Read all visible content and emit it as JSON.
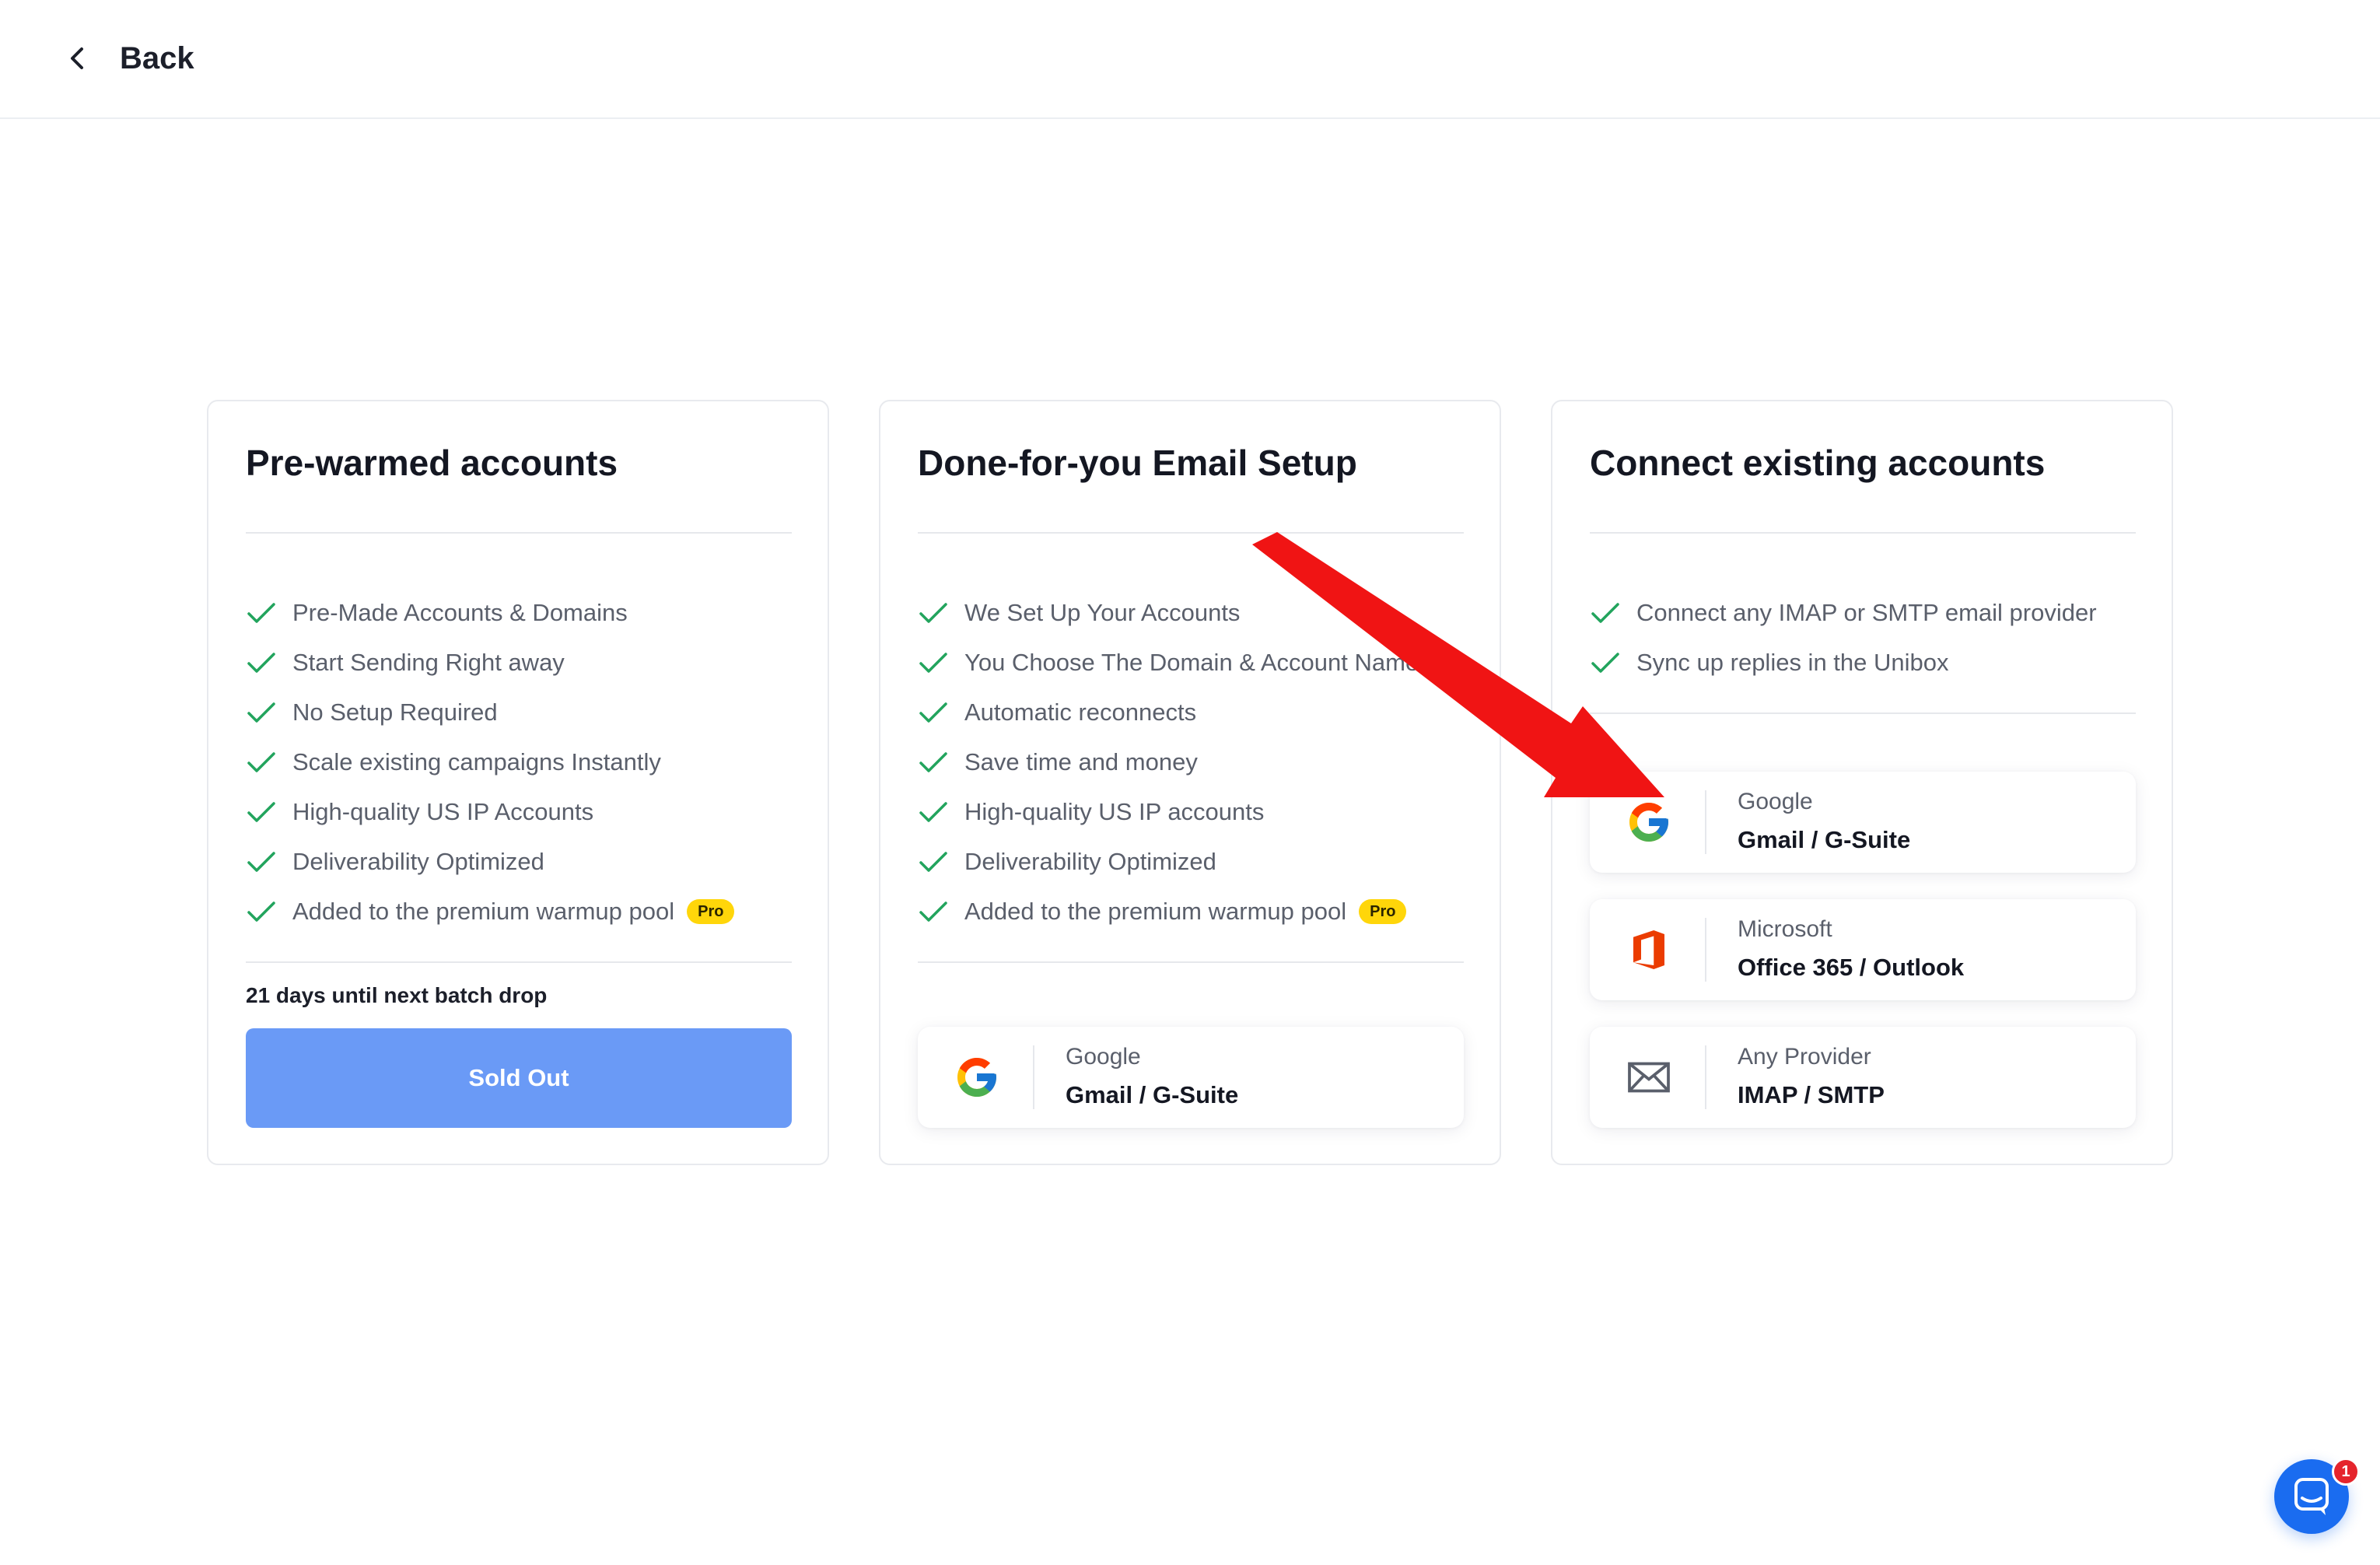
{
  "header": {
    "back_label": "Back"
  },
  "cards": [
    {
      "title": "Pre-warmed accounts",
      "features": [
        "Pre-Made Accounts & Domains",
        "Start Sending Right away",
        "No Setup Required",
        "Scale existing campaigns Instantly",
        "High-quality US IP Accounts",
        "Deliverability Optimized",
        "Added to the premium warmup pool"
      ],
      "pro_badge": "Pro",
      "batch_text": "21 days until next batch drop",
      "button_label": "Sold Out"
    },
    {
      "title": "Done-for-you Email Setup",
      "features": [
        "We Set Up Your Accounts",
        "You Choose The Domain & Account Names",
        "Automatic reconnects",
        "Save time and money",
        "High-quality US IP accounts",
        "Deliverability Optimized",
        "Added to the premium warmup pool"
      ],
      "pro_badge": "Pro",
      "provider": {
        "name": "Google",
        "product": "Gmail / G-Suite",
        "icon": "google-icon"
      }
    },
    {
      "title": "Connect existing accounts",
      "features": [
        "Connect any IMAP or SMTP email provider",
        "Sync up replies in the Unibox"
      ],
      "providers": [
        {
          "name": "Google",
          "product": "Gmail / G-Suite",
          "icon": "google-icon"
        },
        {
          "name": "Microsoft",
          "product": "Office 365 / Outlook",
          "icon": "office-icon"
        },
        {
          "name": "Any Provider",
          "product": "IMAP / SMTP",
          "icon": "envelope-icon"
        }
      ]
    }
  ],
  "chat": {
    "badge_count": "1"
  },
  "colors": {
    "check": "#22a45d",
    "primary_disabled": "#6a9af6",
    "pro_badge": "#ffd60a",
    "arrow": "#f01414",
    "chat": "#1a6cf0"
  }
}
